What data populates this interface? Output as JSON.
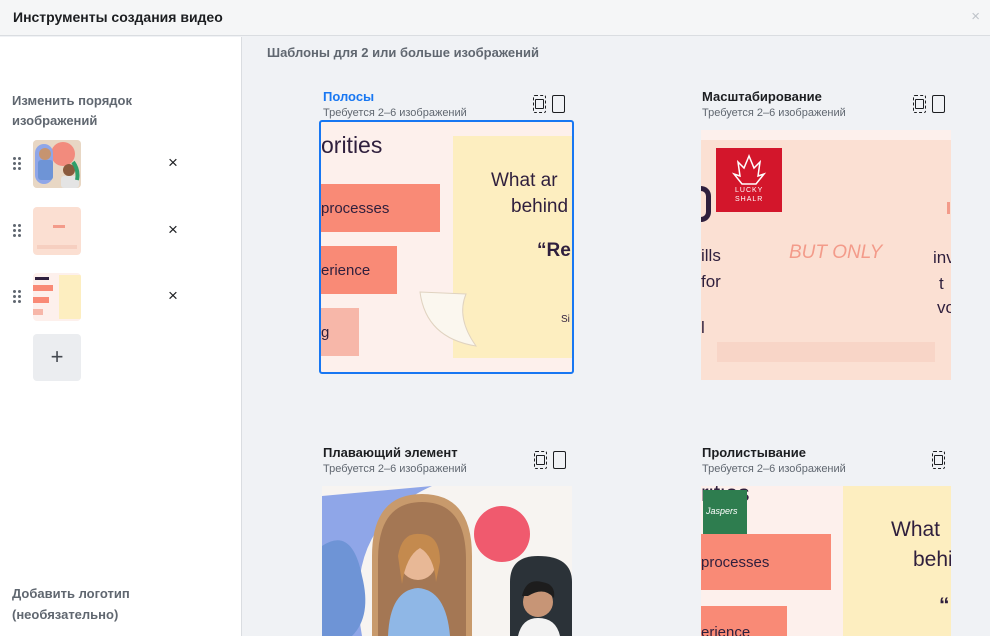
{
  "header": {
    "title": "Инструменты создания видео",
    "close_icon": "×"
  },
  "sidebar": {
    "reorder_heading": "Изменить порядок изображений",
    "images": [
      {
        "name": "photo-people",
        "remove_icon": "×"
      },
      {
        "name": "slide-pink-but-only",
        "remove_icon": "×"
      },
      {
        "name": "slide-priorities",
        "remove_icon": "×"
      }
    ],
    "add_icon": "+",
    "logo_heading": "Добавить логотип (необязательно)"
  },
  "main": {
    "heading": "Шаблоны для 2 или больше изображений",
    "templates": [
      {
        "name": "Полосы",
        "requirement": "Требуется 2–6 изображений",
        "selected": true,
        "preview": {
          "text1": "orities",
          "text2": "processes",
          "text3": "erience",
          "text4": "g",
          "note1": "What ar",
          "note2": "behind",
          "note3": "“Re",
          "note4": "Si"
        }
      },
      {
        "name": "Масштабирование",
        "requirement": "Требуется 2–6 изображений",
        "selected": false,
        "preview": {
          "logo1": "LUCKY",
          "logo2": "SHALR",
          "big": "BUT ONLY",
          "left1": "ills",
          "left2": "for",
          "left3": "l",
          "right1": "inv",
          "right2": "t",
          "right3": "vo"
        }
      },
      {
        "name": "Плавающий элемент",
        "requirement": "Требуется 2–6 изображений",
        "selected": false
      },
      {
        "name": "Пролистывание",
        "requirement": "Требуется 2–6 изображений",
        "selected": false,
        "preview": {
          "logo": "Jaspers",
          "text1": "rities",
          "text2": "processes",
          "text3": "erience",
          "note1": "What",
          "note2": "behi",
          "note3": "“"
        }
      }
    ]
  },
  "colors": {
    "accent": "#1877f2",
    "slide_pink": "#f98a76",
    "slide_yellow": "#fdeec0",
    "slide_bg": "#fdf0ec"
  }
}
